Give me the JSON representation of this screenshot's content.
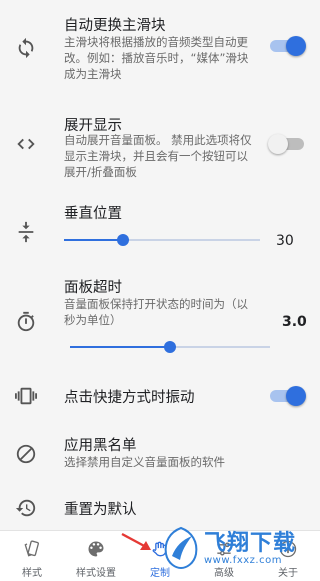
{
  "settings": {
    "auto_switch": {
      "icon": "sync-icon",
      "title": "自动更换主滑块",
      "desc": "主滑块将根据播放的音频类型自动更改。例如：播放音乐时，“媒体”滑块成为主滑块",
      "enabled": true
    },
    "expand": {
      "icon": "expand-code-icon",
      "title": "展开显示",
      "desc": "自动展开音量面板。 禁用此选项将仅显示主滑块，并且会有一个按钮可以展开/折叠面板",
      "enabled": false
    },
    "vertical_position": {
      "icon": "vertical-align-center-icon",
      "title": "垂直位置",
      "value": 30,
      "value_text": "30",
      "min": 0,
      "max": 100
    },
    "panel_timeout": {
      "icon": "timer-icon",
      "title": "面板超时",
      "desc": "音量面板保持打开状态的时间为（以秒为单位）",
      "value": 3.0,
      "value_text": "3.0",
      "min": 0,
      "max": 6
    },
    "vibrate": {
      "icon": "vibration-icon",
      "title": "点击快捷方式时振动",
      "enabled": true
    },
    "blacklist": {
      "icon": "block-icon",
      "title": "应用黑名单",
      "desc": "选择禁用自定义音量面板的软件"
    },
    "reset": {
      "icon": "restore-icon",
      "title": "重置为默认"
    }
  },
  "bottom_nav": {
    "tabs": [
      {
        "label": "样式",
        "icon": "style-cards-icon",
        "active": false
      },
      {
        "label": "样式设置",
        "icon": "palette-icon",
        "active": false
      },
      {
        "label": "定制",
        "icon": "customize-hand-icon",
        "active": true
      },
      {
        "label": "高级",
        "icon": "advanced-icon",
        "active": false
      },
      {
        "label": "关于",
        "icon": "about-icon",
        "active": false
      }
    ]
  },
  "watermark": {
    "text": "飞翔下载",
    "url": "www.fxxz.com"
  },
  "colors": {
    "accent": "#2f6fde",
    "arrow": "#e53935"
  }
}
